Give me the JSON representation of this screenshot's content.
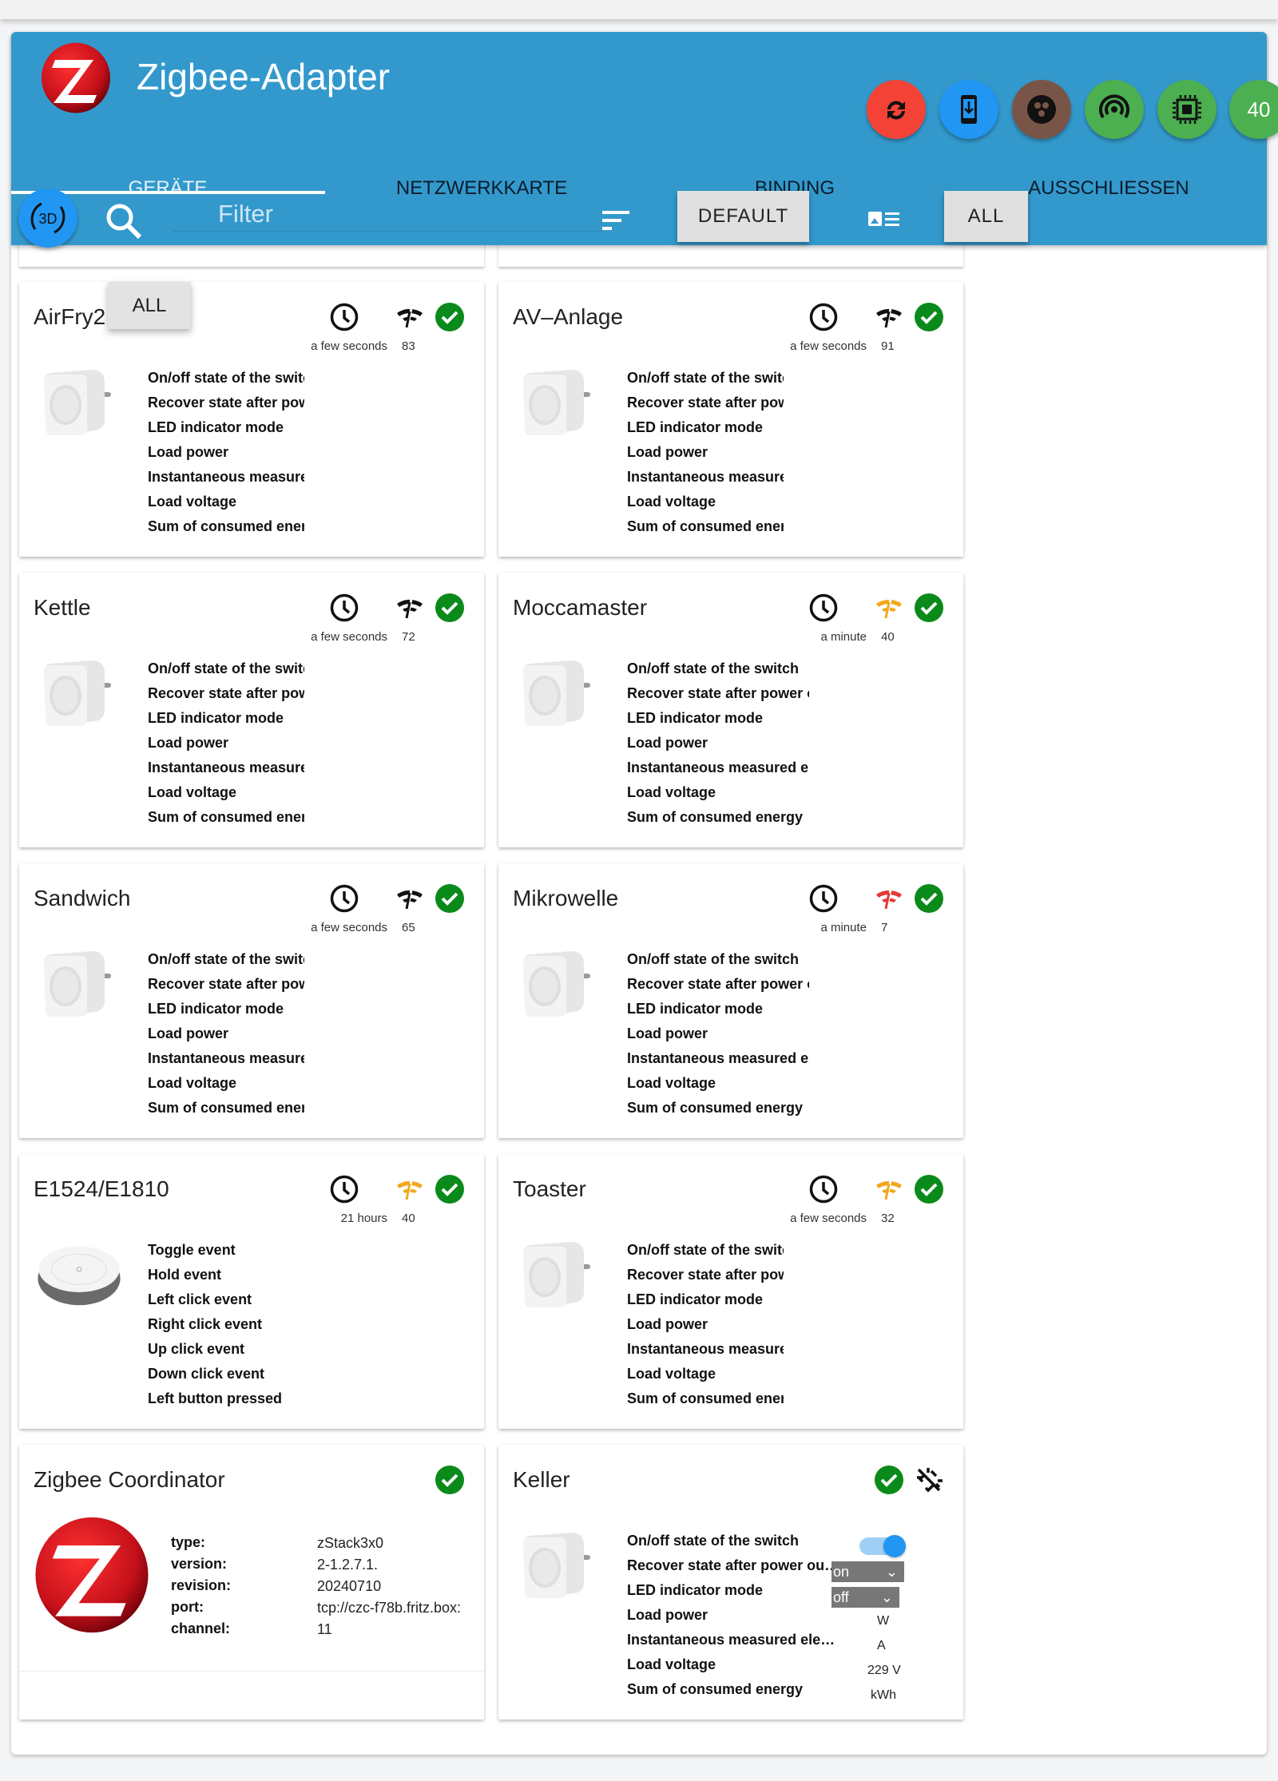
{
  "app": {
    "title": "Zigbee-Adapter"
  },
  "header_buttons": [
    {
      "name": "sync-button",
      "icon": "sync-icon",
      "color": "#f44336"
    },
    {
      "name": "download-device-button",
      "icon": "phone-download-icon",
      "color": "#2196f3"
    },
    {
      "name": "groups-button",
      "icon": "groups-icon",
      "color": "#795548"
    },
    {
      "name": "pairing-button",
      "icon": "broadcast-icon",
      "color": "#4caf50"
    },
    {
      "name": "chip-button",
      "icon": "chip-icon",
      "color": "#4caf50"
    },
    {
      "name": "count-button",
      "label": "40",
      "color": "#4caf50"
    }
  ],
  "tabs": [
    {
      "label": "GERÄTE",
      "active": true
    },
    {
      "label": "NETZWERKKARTE"
    },
    {
      "label": "BINDING"
    },
    {
      "label": "AUSSCHLIESSEN"
    }
  ],
  "toolbar": {
    "btn3d": "3D",
    "filter_placeholder": "Filter",
    "default_label": "DEFAULT",
    "all_label": "ALL"
  },
  "menu": {
    "all_label": "ALL"
  },
  "colors": {
    "header": "#3399cc",
    "ok": "#0a8a1a",
    "link_good": "#111111",
    "link_mid": "#f2a81d",
    "link_bad": "#e53935"
  },
  "plug_labels": [
    "On/off state of the switch",
    "Recover state after power outage",
    "LED indicator mode",
    "Load power",
    "Instantaneous measured electric current",
    "Load voltage",
    "Sum of consumed energy"
  ],
  "devices": [
    {
      "name": "AirFry2",
      "time": "a few seconds",
      "lqi": "83",
      "link": "good",
      "type": "plug",
      "narrow": true
    },
    {
      "name": "AV–Anlage",
      "time": "a few seconds",
      "lqi": "91",
      "link": "good",
      "type": "plug",
      "narrow": true
    },
    {
      "name": "Kettle",
      "time": "a few seconds",
      "lqi": "72",
      "link": "good",
      "type": "plug",
      "narrow": true
    },
    {
      "name": "Moccamaster",
      "time": "a minute",
      "lqi": "40",
      "link": "mid",
      "type": "plug"
    },
    {
      "name": "Sandwich",
      "time": "a few seconds",
      "lqi": "65",
      "link": "good",
      "type": "plug",
      "narrow": true
    },
    {
      "name": "Mikrowelle",
      "time": "a minute",
      "lqi": "7",
      "link": "bad",
      "type": "plug"
    },
    {
      "name": "E1524/E1810",
      "time": "21 hours",
      "lqi": "40",
      "link": "mid",
      "type": "remote",
      "labels": [
        "Toggle event",
        "Hold event",
        "Left click event",
        "Right click event",
        "Up click event",
        "Down click event",
        "Left button pressed"
      ]
    },
    {
      "name": "Toaster",
      "time": "a few seconds",
      "lqi": "32",
      "link": "mid",
      "type": "plug",
      "narrow": true
    }
  ],
  "coordinator": {
    "name": "Zigbee Coordinator",
    "rows": [
      {
        "label": "type:",
        "value": "zStack3x0"
      },
      {
        "label": "version:",
        "value": "2-1.2.7.1."
      },
      {
        "label": "revision:",
        "value": "20240710"
      },
      {
        "label": "port:",
        "value": "tcp://czc-f78b.fritz.box:"
      },
      {
        "label": "channel:",
        "value": "11"
      }
    ]
  },
  "keller": {
    "name": "Keller",
    "labels": [
      "On/off state of the switch",
      "Recover state after power ou…",
      "LED indicator mode",
      "Load power",
      "Instantaneous measured ele…",
      "Load voltage",
      "Sum of consumed energy"
    ],
    "switch_on": true,
    "recover": "on",
    "led": "off",
    "power": "W",
    "current": "A",
    "voltage": "229 V",
    "energy": "kWh"
  }
}
